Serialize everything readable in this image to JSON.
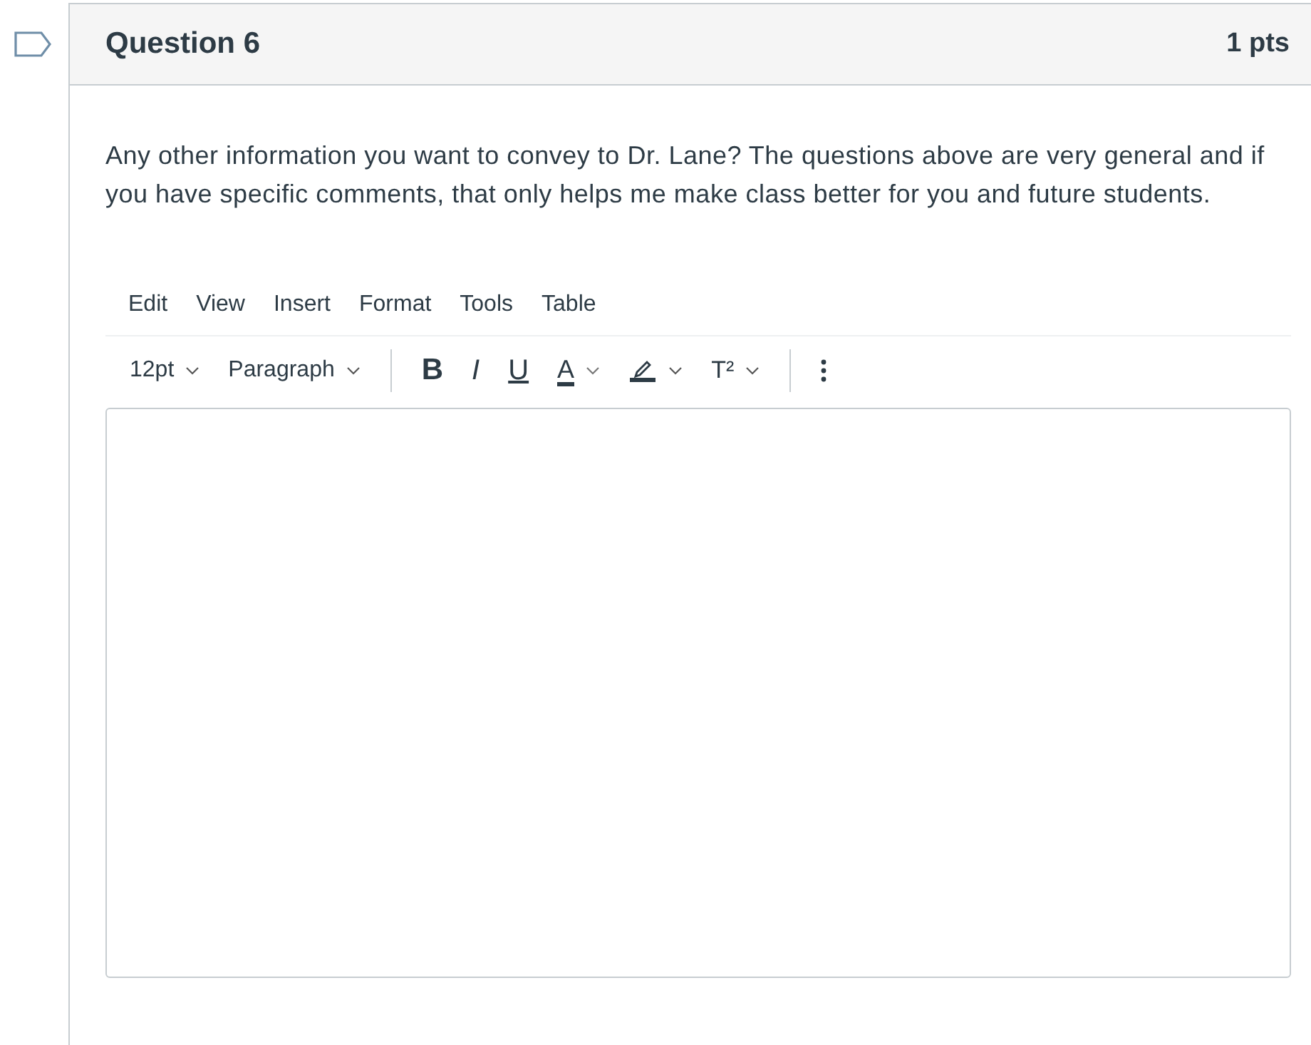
{
  "question": {
    "flagged": false,
    "title": "Question 6",
    "points": "1 pts",
    "text": "Any other information you want to convey to Dr. Lane?  The questions above are very general and if you have specific comments, that only helps me make class better for you and future students."
  },
  "editor": {
    "menu": [
      "Edit",
      "View",
      "Insert",
      "Format",
      "Tools",
      "Table"
    ],
    "toolbar": [
      {
        "kind": "dropdown",
        "label": "12pt"
      },
      {
        "kind": "dropdown",
        "label": "Paragraph"
      },
      {
        "kind": "separator"
      },
      {
        "kind": "bold",
        "label": "B"
      },
      {
        "kind": "italic",
        "label": "I"
      },
      {
        "kind": "underline",
        "label": "U"
      },
      {
        "kind": "color",
        "label": "A"
      },
      {
        "kind": "highlight"
      },
      {
        "kind": "superscript",
        "label": "T²"
      },
      {
        "kind": "separator"
      },
      {
        "kind": "more"
      }
    ]
  }
}
